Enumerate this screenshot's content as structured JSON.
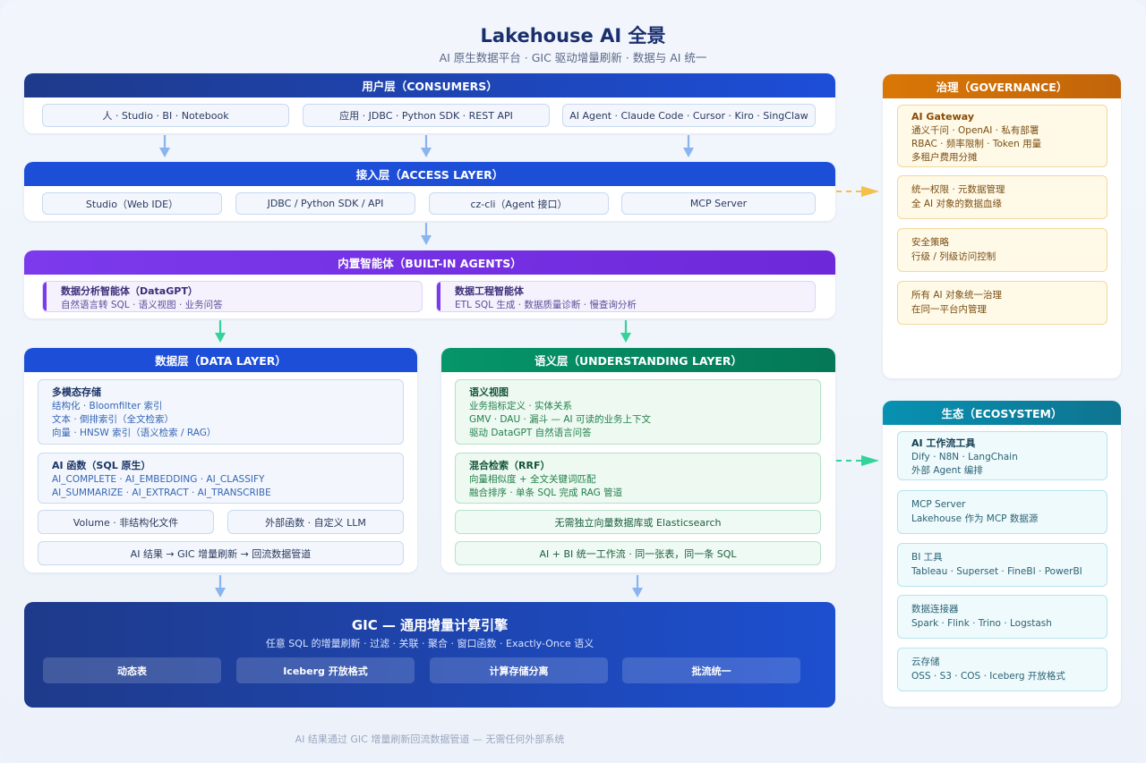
{
  "header": {
    "title": "Lakehouse AI 全景",
    "subtitle": "AI 原生数据平台 · GIC 驱动增量刷新 · 数据与 AI 统一"
  },
  "consumers": {
    "title": "用户层（CONSUMERS）",
    "items": [
      "人 · Studio · BI · Notebook",
      "应用 · JDBC · Python SDK · REST API",
      "AI Agent · Claude Code · Cursor · Kiro · SingClaw"
    ]
  },
  "access": {
    "title": "接入层（ACCESS LAYER）",
    "items": [
      "Studio（Web IDE）",
      "JDBC / Python SDK / API",
      "cz-cli（Agent 接口）",
      "MCP Server"
    ]
  },
  "agents": {
    "title": "内置智能体（BUILT-IN AGENTS）",
    "items": [
      {
        "title": "数据分析智能体（DataGPT）",
        "desc": "自然语言转 SQL · 语义视图 · 业务问答"
      },
      {
        "title": "数据工程智能体",
        "desc": "ETL SQL 生成 · 数据质量诊断 · 慢查询分析"
      }
    ]
  },
  "data_layer": {
    "title": "数据层（DATA LAYER）",
    "storage": {
      "title": "多模态存储",
      "lines": [
        "结构化 · Bloomfilter 索引",
        "文本 · 倒排索引（全文检索）",
        "向量 · HNSW 索引（语义检索 / RAG）"
      ]
    },
    "functions": {
      "title": "AI 函数（SQL 原生）",
      "lines": [
        "AI_COMPLETE · AI_EMBEDDING · AI_CLASSIFY",
        "AI_SUMMARIZE · AI_EXTRACT · AI_TRANSCRIBE"
      ]
    },
    "volume": "Volume · 非结构化文件",
    "external": "外部函数 · 自定义 LLM",
    "pipeline": "AI 结果 → GIC 增量刷新 → 回流数据管道"
  },
  "understanding": {
    "title": "语义层（UNDERSTANDING LAYER）",
    "semantic": {
      "title": "语义视图",
      "lines": [
        "业务指标定义 · 实体关系",
        "GMV · DAU · 漏斗 — AI 可读的业务上下文",
        "驱动 DataGPT 自然语言问答"
      ]
    },
    "hybrid": {
      "title": "混合检索（RRF）",
      "lines": [
        "向量相似度 + 全文关键词匹配",
        "融合排序 · 单条 SQL 完成 RAG 管道"
      ]
    },
    "no_vector_db": "无需独立向量数据库或 Elasticsearch",
    "unified": "AI + BI 统一工作流 · 同一张表，同一条 SQL"
  },
  "gic": {
    "title": "GIC — 通用增量计算引擎",
    "subtitle": "任意 SQL 的增量刷新 · 过滤 · 关联 · 聚合 · 窗口函数 · Exactly-Once 语义",
    "chips": [
      "动态表",
      "Iceberg 开放格式",
      "计算存储分离",
      "批流统一"
    ]
  },
  "governance": {
    "title": "治理（GOVERNANCE）",
    "cards": [
      {
        "title": "AI Gateway",
        "lines": [
          "通义千问 · OpenAI · 私有部署",
          "RBAC · 频率限制 · Token 用量",
          "多租户费用分摊"
        ]
      },
      {
        "title": "",
        "lines": [
          "统一权限 · 元数据管理",
          "全 AI 对象的数据血缘"
        ]
      },
      {
        "title": "",
        "lines": [
          "安全策略",
          "行级 / 列级访问控制"
        ]
      },
      {
        "title": "",
        "lines": [
          "所有 AI 对象统一治理",
          "在同一平台内管理"
        ]
      }
    ]
  },
  "ecosystem": {
    "title": "生态（ECOSYSTEM）",
    "cards": [
      {
        "title": "AI 工作流工具",
        "lines": [
          "Dify · N8N · LangChain",
          "外部 Agent 编排"
        ]
      },
      {
        "title": "",
        "lines": [
          "MCP Server",
          "Lakehouse 作为 MCP 数据源"
        ]
      },
      {
        "title": "",
        "lines": [
          "BI 工具",
          "Tableau · Superset · FineBI · PowerBI"
        ]
      },
      {
        "title": "",
        "lines": [
          "数据连接器",
          "Spark · Flink · Trino · Logstash"
        ]
      },
      {
        "title": "",
        "lines": [
          "云存储",
          "OSS · S3 · COS · Iceberg 开放格式"
        ]
      }
    ]
  },
  "footer": "AI 结果通过 GIC 增量刷新回流数据管道 — 无需任何外部系统",
  "colors": {
    "consumers_head": "#1e3a8a",
    "access_head": "#1d4ed8",
    "agents_head": "#7c3aed",
    "data_head": "#1d4ed8",
    "understanding_head": "#047857",
    "governance_head": "#d97706",
    "ecosystem_head": "#0e7490"
  }
}
